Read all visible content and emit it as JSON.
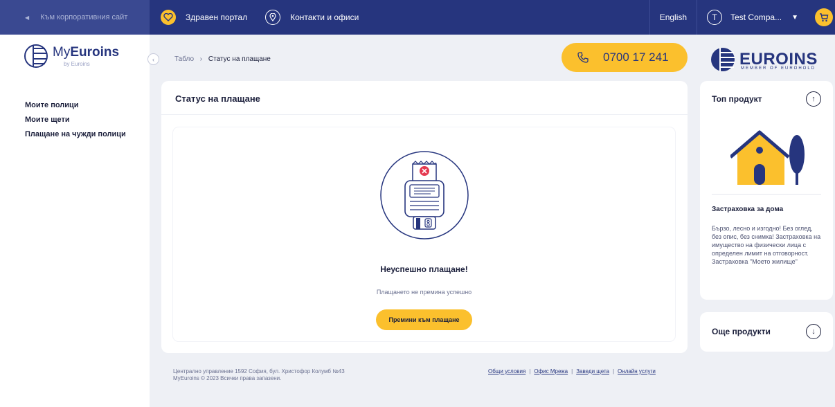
{
  "topbar": {
    "corporate_link": "Към корпоративния сайт",
    "health_portal": "Здравен портал",
    "contacts": "Контакти и офиси",
    "language": "English",
    "user_initial": "T",
    "user_name": "Test Compa..."
  },
  "sidebar": {
    "logo_main_light": "My",
    "logo_main_bold": "Euroins",
    "logo_sub": "by Euroins",
    "items": [
      {
        "label": "Моите полици"
      },
      {
        "label": "Моите щети"
      },
      {
        "label": "Плащане на чужди полици"
      }
    ]
  },
  "breadcrumb": {
    "home": "Табло",
    "separator": "›",
    "current": "Статус на плащане"
  },
  "phone": "0700 17 241",
  "brand": {
    "name": "EUROINS",
    "tagline": "MEMBER OF EUROHOLD"
  },
  "main": {
    "title": "Статус на плащане",
    "status_title": "Неуспешно плащане!",
    "status_message": "Плащането не премина успешно",
    "action_button": "Премини към плащане"
  },
  "footer": {
    "address_line1": "Централно управление 1592 София, бул. Христофор Колумб №43",
    "address_line2": "MyEuroins © 2023 Всички права запазени.",
    "links": [
      {
        "label": "Общи условия"
      },
      {
        "label": "Офис Мрежа"
      },
      {
        "label": "Заведи щета"
      },
      {
        "label": "Онлайн услуги"
      }
    ]
  },
  "right": {
    "top_title": "Топ продукт",
    "product_name": "Застраховка за дома",
    "product_desc": "Бързо, лесно и изгодно! Без оглед, без опис, без снимка! Застраховка на имущество на физически лица с определен лимит на отговорност. Застраховка \"Моето жилище\"",
    "more_title": "Още продукти"
  },
  "colors": {
    "navy": "#26357e",
    "accent_yellow": "#fbc02d",
    "error_red": "#e53950"
  }
}
